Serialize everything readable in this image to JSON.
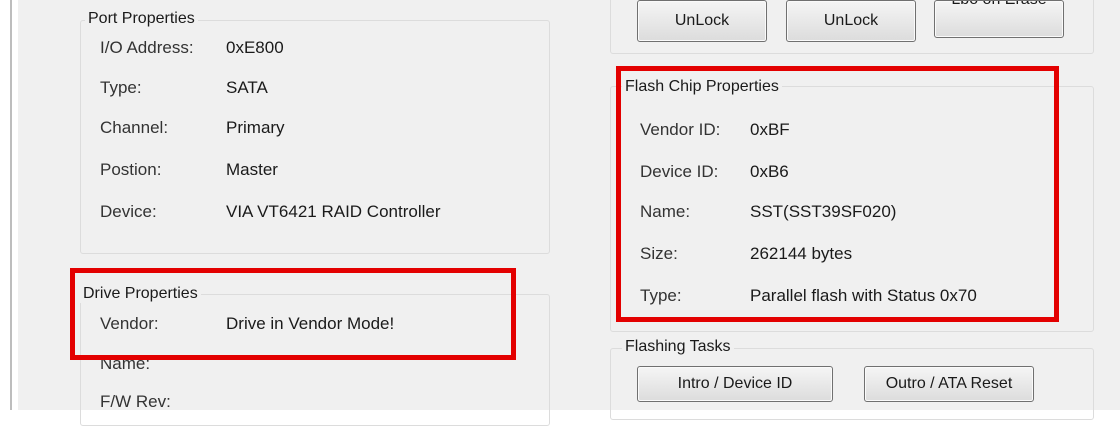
{
  "port_properties": {
    "title": "Port Properties",
    "rows": [
      {
        "label": "I/O Address:",
        "value": "0xE800"
      },
      {
        "label": "Type:",
        "value": "SATA"
      },
      {
        "label": "Channel:",
        "value": "Primary"
      },
      {
        "label": "Postion:",
        "value": "Master"
      },
      {
        "label": "Device:",
        "value": "VIA VT6421 RAID Controller"
      }
    ]
  },
  "drive_properties": {
    "title": "Drive Properties",
    "rows": [
      {
        "label": "Vendor:",
        "value": "Drive in Vendor Mode!"
      },
      {
        "label": "Name:",
        "value": ""
      },
      {
        "label": "F/W Rev:",
        "value": ""
      }
    ]
  },
  "lock_buttons": {
    "unlock1": "UnLock",
    "unlock2": "UnLock",
    "third_partial": "Lbo on Erase"
  },
  "flash_chip_properties": {
    "title": "Flash Chip Properties",
    "rows": [
      {
        "label": "Vendor ID:",
        "value": "0xBF"
      },
      {
        "label": "Device ID:",
        "value": "0xB6"
      },
      {
        "label": "Name:",
        "value": "SST(SST39SF020)"
      },
      {
        "label": "Size:",
        "value": "262144 bytes"
      },
      {
        "label": "Type:",
        "value": "Parallel flash with Status 0x70"
      }
    ]
  },
  "flashing_tasks": {
    "title": "Flashing Tasks",
    "intro_button": "Intro / Device ID",
    "outro_button": "Outro / ATA Reset"
  },
  "colors": {
    "highlight": "#e30000",
    "panel_background": "#f0f0f0"
  }
}
